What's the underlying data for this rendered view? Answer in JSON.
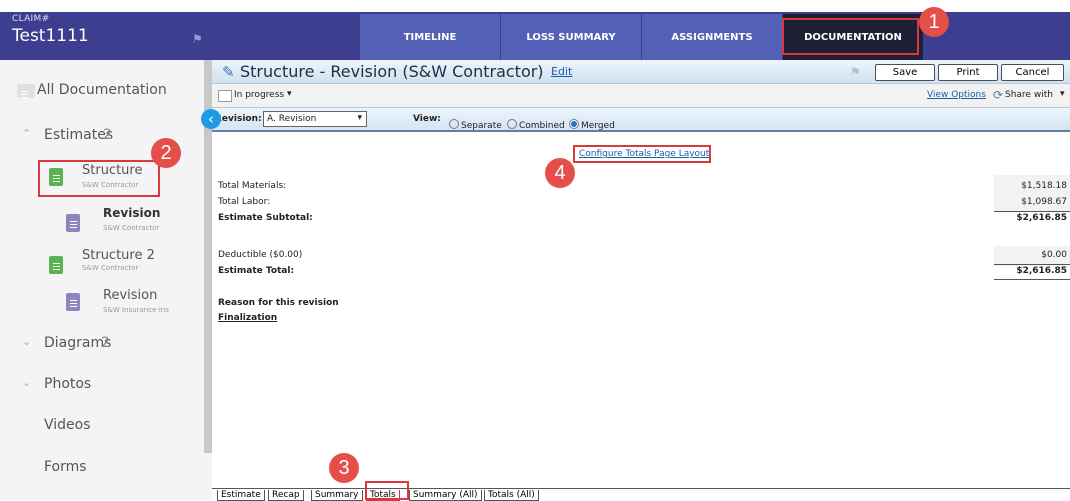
{
  "topbar": {
    "claim_label": "CLAIM#",
    "claim_value": "Test1111",
    "tabs": [
      "TIMELINE",
      "LOSS SUMMARY",
      "ASSIGNMENTS",
      "DOCUMENTATION"
    ],
    "badges": [
      "1",
      "2",
      "3",
      "4"
    ]
  },
  "sidebar": {
    "all_documentation": "All Documentation",
    "estimates_label": "Estimates",
    "estimates_count": "2",
    "items": [
      {
        "title": "Structure",
        "meta": "S&W Contractor"
      },
      {
        "title": "Revision",
        "meta": "S&W Contractor"
      },
      {
        "title": "Structure 2",
        "meta": "S&W Contractor"
      },
      {
        "title": "Revision",
        "meta": "S&W Insurance-ins"
      }
    ],
    "diagrams_label": "Diagrams",
    "diagrams_count": "2",
    "photos_label": "Photos",
    "videos_label": "Videos",
    "forms_label": "Forms"
  },
  "main": {
    "title": "Structure - Revision (S&W Contractor)",
    "edit": "Edit",
    "save": "Save",
    "print": "Print",
    "cancel": "Cancel",
    "status": "In progress",
    "view_options": "View Options",
    "share_with": "Share with",
    "revision_label": "Revision:",
    "revision_value": "A. Revision",
    "view_label": "View:",
    "view_separate": "Separate",
    "view_combined": "Combined",
    "view_merged": "Merged",
    "configure_link": "Configure Totals Page Layout",
    "rows": [
      {
        "label": "Total Materials:",
        "value": "$1,518.18"
      },
      {
        "label": "Total Labor:",
        "value": "$1,098.67"
      },
      {
        "label": "Estimate Subtotal:",
        "value": "$2,616.85"
      },
      {
        "label": "Deductible ($0.00)",
        "value": "$0.00"
      },
      {
        "label": "Estimate Total:",
        "value": "$2,616.85"
      }
    ],
    "reason_label": "Reason for this revision",
    "reason_value": "Finalization"
  },
  "bottom_tabs": [
    "Estimate",
    "Recap",
    "Summary",
    "Totals",
    "Summary (All)",
    "Totals (All)"
  ]
}
